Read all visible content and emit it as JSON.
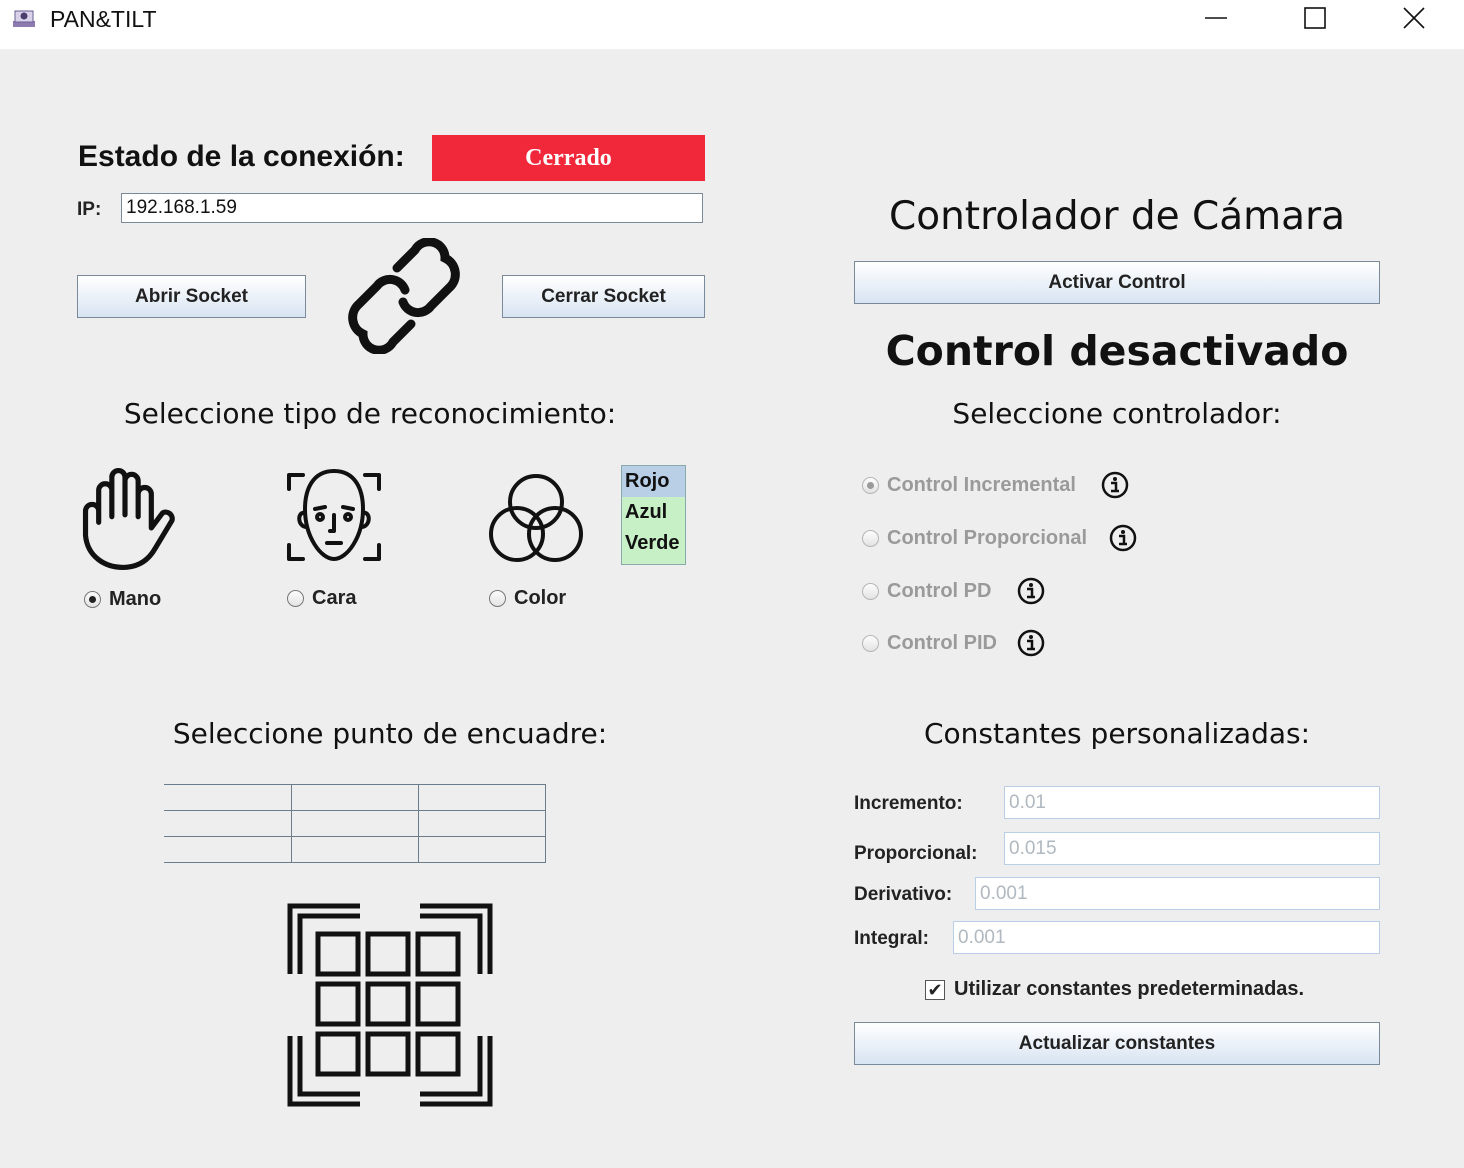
{
  "window": {
    "title": "PAN&TILT",
    "minimize_label": "—",
    "maximize_label": "☐",
    "close_label": "✕"
  },
  "connection": {
    "label": "Estado de la conexión:",
    "status": "Cerrado",
    "status_color": "#f1273a",
    "ip_label": "IP:",
    "ip_value": "192.168.1.59",
    "open_button": "Abrir Socket",
    "close_button": "Cerrar Socket",
    "link_icon": "link-icon"
  },
  "recognition": {
    "title": "Seleccione tipo de reconocimiento:",
    "options": [
      {
        "label": "Mano",
        "icon": "hand-icon",
        "selected": true
      },
      {
        "label": "Cara",
        "icon": "face-scan-icon",
        "selected": false
      },
      {
        "label": "Color",
        "icon": "color-circles-icon",
        "selected": false
      }
    ],
    "colors": [
      "Rojo",
      "Azul",
      "Verde"
    ],
    "selected_color": "Rojo"
  },
  "framing": {
    "title": "Seleccione punto de encuadre:",
    "icon": "framing-grid-icon"
  },
  "controller": {
    "title": "Controlador de Cámara",
    "activate_button": "Activar Control",
    "status": "Control desactivado",
    "select_title": "Seleccione controlador:",
    "options": [
      {
        "label": "Control Incremental",
        "selected": true
      },
      {
        "label": "Control Proporcional",
        "selected": false
      },
      {
        "label": "Control PD",
        "selected": false
      },
      {
        "label": "Control PID",
        "selected": false
      }
    ]
  },
  "constants": {
    "title": "Constantes personalizadas:",
    "fields": [
      {
        "label": "Incremento:",
        "value": "0.01"
      },
      {
        "label": "Proporcional:",
        "value": "0.015"
      },
      {
        "label": "Derivativo:",
        "value": "0.001"
      },
      {
        "label": "Integral:",
        "value": "0.001"
      }
    ],
    "default_checkbox_label": "Utilizar constantes predeterminadas.",
    "default_checked": true,
    "update_button": "Actualizar constantes"
  }
}
